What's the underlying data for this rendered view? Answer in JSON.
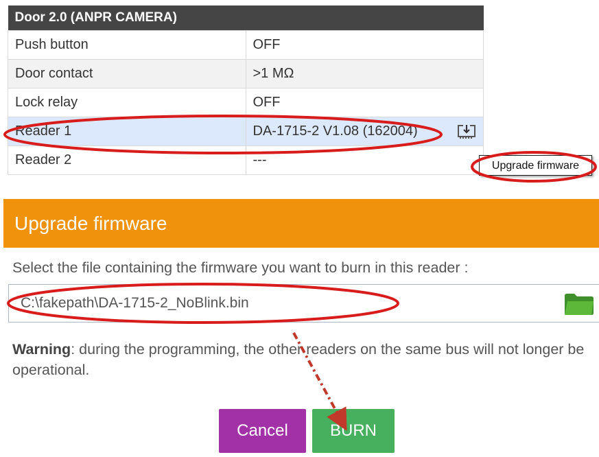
{
  "door": {
    "title": "Door 2.0 (ANPR CAMERA)",
    "rows": [
      {
        "label": "Push button",
        "value": "OFF"
      },
      {
        "label": "Door contact",
        "value": ">1 MΩ"
      },
      {
        "label": "Lock relay",
        "value": "OFF"
      },
      {
        "label": "Reader 1",
        "value": "DA-1715-2 V1.08 (162004)"
      },
      {
        "label": "Reader 2",
        "value": "---"
      }
    ],
    "tooltip": "Upgrade firmware"
  },
  "dialog": {
    "title": "Upgrade firmware",
    "instruction": "Select the file containing the firmware you want to burn in this reader :",
    "file_value": "C:\\fakepath\\DA-1715-2_NoBlink.bin",
    "warning_label": "Warning",
    "warning_text": ": during the programming, the other readers on the same bus will not longer be operational.",
    "cancel_label": "Cancel",
    "burn_label": "BURN"
  },
  "colors": {
    "header_orange": "#f0920b",
    "cancel_purple": "#a230a6",
    "burn_green": "#47b05f",
    "annotation_red": "#d81c1c"
  }
}
